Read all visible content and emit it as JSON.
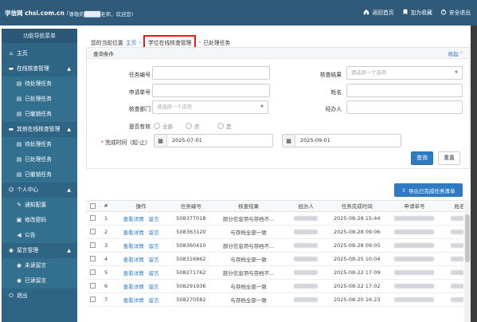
{
  "topbar": {
    "brand": "学信网 chsi.com.cn",
    "greeting": "「尊敬的████老师，欢迎您!",
    "links": [
      {
        "icon": "home-icon",
        "label": "返回首页"
      },
      {
        "icon": "bookmark-icon",
        "label": "加为收藏"
      },
      {
        "icon": "power-icon",
        "label": "安全退出"
      }
    ]
  },
  "sidebar": {
    "title": "功能导航菜单",
    "items": [
      {
        "icon": "home-icon",
        "label": "主页",
        "type": "group"
      },
      {
        "icon": "folder-icon",
        "label": "在线核查管理",
        "type": "group",
        "caret": "▲"
      },
      {
        "icon": "document-icon",
        "label": "待处理任务",
        "type": "sub"
      },
      {
        "icon": "document-icon",
        "label": "已处理任务",
        "type": "sub"
      },
      {
        "icon": "document-icon",
        "label": "已撤销任务",
        "type": "sub"
      },
      {
        "icon": "folder-icon",
        "label": "其他在线核查管理",
        "type": "group",
        "caret": "▲"
      },
      {
        "icon": "document-icon",
        "label": "待处理任务",
        "type": "sub"
      },
      {
        "icon": "document-icon",
        "label": "已处理任务",
        "type": "sub"
      },
      {
        "icon": "document-icon",
        "label": "已撤销任务",
        "type": "sub"
      },
      {
        "icon": "user-icon",
        "label": "个人中心",
        "type": "group",
        "caret": "▲"
      },
      {
        "icon": "wrench-icon",
        "label": "通知配置",
        "type": "sub"
      },
      {
        "icon": "lock-icon",
        "label": "修改密码",
        "type": "sub"
      },
      {
        "icon": "megaphone-icon",
        "label": "公告",
        "type": "sub"
      },
      {
        "icon": "comment-icon",
        "label": "留言管理",
        "type": "group",
        "caret": "▲"
      },
      {
        "icon": "comment-icon",
        "label": "未读留言",
        "type": "sub"
      },
      {
        "icon": "comment-icon",
        "label": "已读留言",
        "type": "sub"
      },
      {
        "icon": "power-icon",
        "label": "退出",
        "type": "group"
      }
    ]
  },
  "breadcrumb": {
    "prefix": "您的当前位置",
    "home": "主页",
    "current": "学位在线核查管理",
    "last": "已处理任务"
  },
  "search": {
    "title": "查询条件",
    "collapse": "收起",
    "fields": {
      "task_no": {
        "label": "任务编号",
        "value": ""
      },
      "result": {
        "label": "核查结果",
        "placeholder": "请选择一个选项"
      },
      "applicant_no": {
        "label": "申请单号",
        "value": ""
      },
      "name": {
        "label": "姓名",
        "value": ""
      },
      "dept": {
        "label": "核查部门",
        "placeholder": "请选择一个选项"
      },
      "handler": {
        "label": "经办人",
        "value": ""
      },
      "valid": {
        "label": "是否有效",
        "options": [
          "全部",
          "否",
          "是"
        ]
      },
      "time": {
        "label": "完成时间（起-止）",
        "start": "2025-07-01",
        "end": "2025-09-01"
      }
    },
    "query_btn": "查询",
    "reset_btn": "重置"
  },
  "export_btn": "导出已完成任务清单",
  "table": {
    "columns": [
      "#",
      "操作",
      "任务编号",
      "核查结果",
      "经办人",
      "任务完成时间",
      "申请单号",
      "姓名"
    ],
    "actions": [
      "查看详情",
      "留言"
    ],
    "rows": [
      {
        "n": "1",
        "task": "508377018",
        "result": "部分信息项与存档不...",
        "time": "2025-08-28 15:44"
      },
      {
        "n": "2",
        "task": "508363120",
        "result": "与存档全部一致",
        "time": "2025-08-28 09:06"
      },
      {
        "n": "3",
        "task": "508360410",
        "result": "部分信息项与存档不...",
        "time": "2025-08-28 09:05"
      },
      {
        "n": "4",
        "task": "508316862",
        "result": "与存档全部一致",
        "time": "2025-08-25 10:04"
      },
      {
        "n": "5",
        "task": "508271762",
        "result": "部分信息项与存档不...",
        "time": "2025-08-22 17:09"
      },
      {
        "n": "6",
        "task": "508291936",
        "result": "与存档全部一致",
        "time": "2025-08-22 17:02"
      },
      {
        "n": "7",
        "task": "508270582",
        "result": "与存档全部一致",
        "time": "2025-08-20 16:23"
      }
    ]
  }
}
